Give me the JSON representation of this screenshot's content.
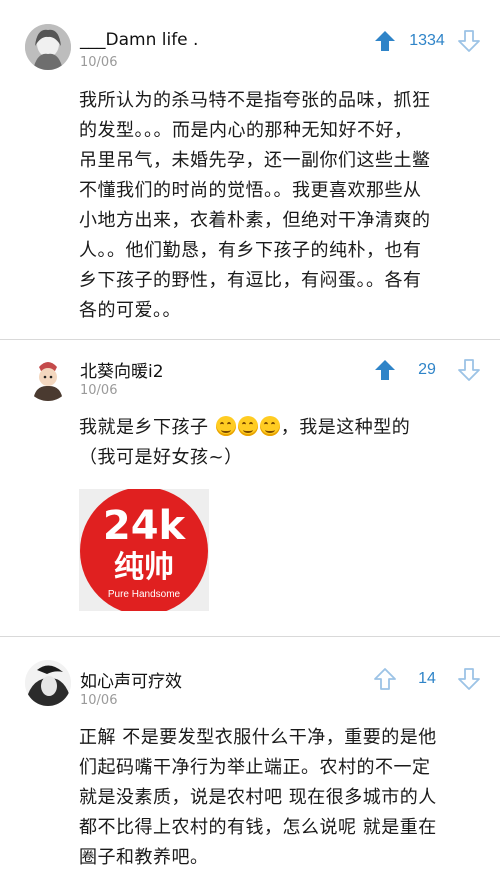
{
  "comments": [
    {
      "username": "___Damn   life .",
      "date": "10/06",
      "votes": "1334",
      "vote_state": "upvoted",
      "text_lines": [
        "我所认为的杀马特不是指夸张的品味，抓狂",
        "的发型。。。而是内心的那种无知好不好，",
        "吊里吊气，未婚先孕，还一副你们这些土鳖",
        "不懂我们的时尚的觉悟。。我更喜欢那些从",
        "小地方出来，衣着朴素，但绝对干净清爽的",
        "人。。他们勤恳，有乡下孩子的纯朴，也有",
        "乡下孩子的野性，有逗比，有闷蛋。。各有",
        "各的可爱。。"
      ]
    },
    {
      "username": "北葵向暖i2",
      "date": "10/06",
      "votes": "29",
      "vote_state": "upvoted",
      "line1_before": "我就是乡下孩子",
      "line1_after": "，我是这种型的",
      "line2": "（我可是好女孩~）",
      "image": {
        "big_text": "24k",
        "chinese_text": "纯帅",
        "sub_text": "Pure Handsome"
      }
    },
    {
      "username": "如心声可疗效",
      "date": "10/06",
      "votes": "14",
      "vote_state": "neutral",
      "text_lines": [
        "正解 不是要发型衣服什么干净，重要的是他",
        "们起码嘴干净行为举止端正。农村的不一定",
        "就是没素质，说是农村吧 现在很多城市的人",
        "都不比得上农村的有钱，怎么说呢 就是重在",
        "圈子和教养吧。"
      ]
    }
  ],
  "colors": {
    "accent": "#2f84c8",
    "accent_light": "#9cc3e6",
    "divider": "#d9d9d9",
    "badge_red": "#e02020"
  }
}
